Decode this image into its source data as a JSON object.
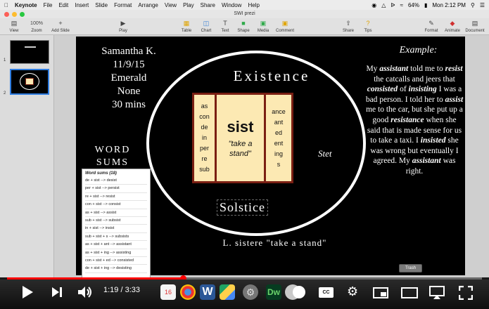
{
  "menubar": {
    "app": "Keynote",
    "items": [
      "File",
      "Edit",
      "Insert",
      "Slide",
      "Format",
      "Arrange",
      "View",
      "Play",
      "Share",
      "Window",
      "Help"
    ],
    "battery": "64%",
    "clock": "Mon 2:12 PM"
  },
  "window": {
    "title": "SWI prezi"
  },
  "toolbar": {
    "view": "View",
    "zoom_value": "100%",
    "zoom": "Zoom",
    "add_slide": "Add Slide",
    "play": "Play",
    "table": "Table",
    "chart": "Chart",
    "text": "Text",
    "shape": "Shape",
    "media": "Media",
    "comment": "Comment",
    "share": "Share",
    "tips": "Tips",
    "format": "Format",
    "animate": "Animate",
    "document": "Document"
  },
  "sidebar": {
    "slides": [
      "1",
      "2"
    ],
    "selected": "2"
  },
  "slide": {
    "info": [
      "Samantha K.",
      "11/9/15",
      "Emerald",
      "None",
      "30 mins"
    ],
    "word_sums_heading": [
      "WORD",
      "SUMS"
    ],
    "title": "Existence",
    "prefixes": [
      "as",
      "con",
      "de",
      "in",
      "per",
      "re",
      "sub"
    ],
    "base": "sist",
    "base_meaning": "\"take a stand\"",
    "suffixes": [
      "ance",
      "ant",
      "ed",
      "ent",
      "ing",
      "s"
    ],
    "stet": "Stet",
    "solstice": "Solstice",
    "latin": "L. sistere \"take a stand\"",
    "example_title": "Example:",
    "example": [
      {
        "t": "My ",
        "b": false
      },
      {
        "t": "assistant",
        "b": true
      },
      {
        "t": " told me to ",
        "b": false
      },
      {
        "t": "resist",
        "b": true
      },
      {
        "t": " the catcalls and jeers that ",
        "b": false
      },
      {
        "t": "consisted",
        "b": true
      },
      {
        "t": " of ",
        "b": false
      },
      {
        "t": "insisting",
        "b": true
      },
      {
        "t": " I was a bad person. I told her to ",
        "b": false
      },
      {
        "t": "assist",
        "b": true
      },
      {
        "t": " me to the car, but she put up a good ",
        "b": false
      },
      {
        "t": "resistance",
        "b": true
      },
      {
        "t": " when she said that is made sense for us to take a taxi. I ",
        "b": false
      },
      {
        "t": "insisted",
        "b": true
      },
      {
        "t": " she was wrong but eventually I agreed. My ",
        "b": false
      },
      {
        "t": "assistant",
        "b": true
      },
      {
        "t": " was right.",
        "b": false
      }
    ]
  },
  "sums_panel": {
    "title": "Word sums (18)",
    "rows": [
      "de + sist --> desist",
      "per + sist --> persist",
      "re + sist --> resist",
      "con + sist --> consist",
      "as + sist --> assist",
      "sub + sist --> subsist",
      "in + sist --> insist",
      "sub + sist + s --> subsists",
      "as + sist + ant --> assistant",
      "as + sist + ing --> assisting",
      "con + sist + ed --> consisted",
      "de + sist + ing --> desisting"
    ]
  },
  "trash": "Trash",
  "player": {
    "current": "1:19",
    "duration": "3:33",
    "progress": 0.371,
    "played_color": "#ff0000"
  },
  "dock": {
    "calendar_day": "16",
    "dreamweaver": "Dw",
    "word": "W"
  }
}
